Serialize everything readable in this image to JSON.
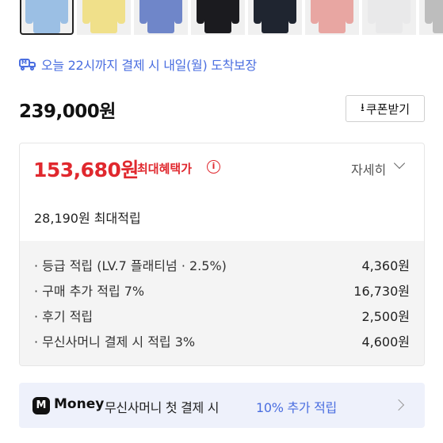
{
  "thumbnails": [
    {
      "name": "thumb-light-blue",
      "color": "#9bbfe4"
    },
    {
      "name": "thumb-yellow",
      "color": "#f0e08a"
    },
    {
      "name": "thumb-blue-stripe",
      "color": "#6f86c9"
    },
    {
      "name": "thumb-black",
      "color": "#1b1b1f"
    },
    {
      "name": "thumb-dark-navy",
      "color": "#1f2530"
    },
    {
      "name": "thumb-pink",
      "color": "#e8a6a2"
    },
    {
      "name": "thumb-white",
      "color": "#e9e9ea"
    },
    {
      "name": "thumb-grey",
      "color": "#bdbdbd"
    }
  ],
  "delivery": {
    "icon": "truck-icon",
    "icon_badge": "M",
    "text": "오늘 22시까지 결제 시 내일(월) 도착보장",
    "color": "#4a6ee0"
  },
  "price": {
    "original": "239,000원",
    "coupon_button": "쿠폰받기",
    "coupon_icon": "download-icon"
  },
  "benefit": {
    "max_price": "153,680원",
    "max_label": "최대혜택가",
    "info_icon": "i",
    "detail_label": "자세히",
    "accumulation": "28,190원 최대적립",
    "items": [
      {
        "label": "· 등급 적립 (LV.7 플래티넘 · 2.5%)",
        "value": "4,360원"
      },
      {
        "label": "· 구매 추가 적립 7%",
        "value": "16,730원"
      },
      {
        "label": "· 후기 적립",
        "value": "2,500원"
      },
      {
        "label": "· 무신사머니 결제 시 적립 3%",
        "value": "4,600원"
      }
    ],
    "accent_color": "#e0282e"
  },
  "money_banner": {
    "logo": "M",
    "brand": "Money",
    "text": "무신사머니 첫 결제 시",
    "highlight": "10% 추가 적립"
  }
}
